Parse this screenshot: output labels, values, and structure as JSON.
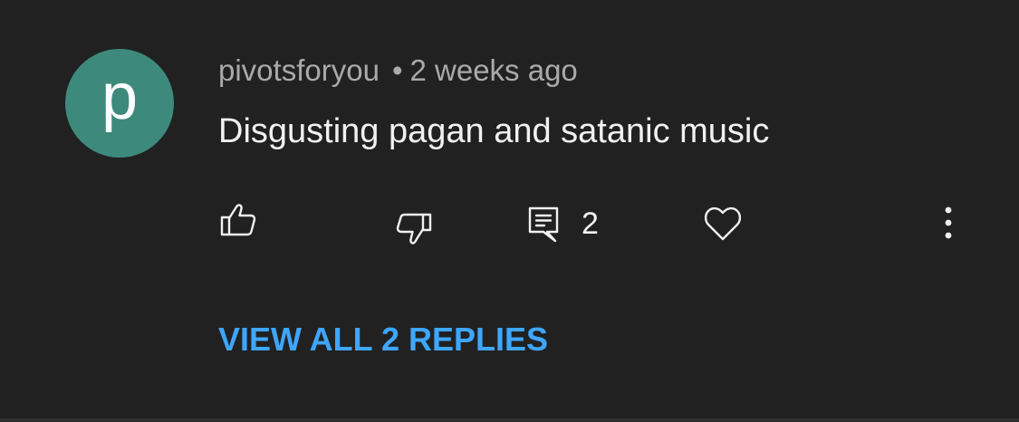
{
  "comment": {
    "avatar_letter": "p",
    "avatar_color": "#3d8a7c",
    "author": "pivotsforyou",
    "separator": "•",
    "timestamp": "2 weeks ago",
    "text": "Disgusting pagan and satanic music",
    "actions": {
      "like_icon": "thumbs-up-icon",
      "dislike_icon": "thumbs-down-icon",
      "reply_icon": "comment-icon",
      "reply_count": "2",
      "heart_icon": "heart-icon",
      "more_icon": "more-vertical-icon"
    },
    "view_replies_label": "VIEW ALL 2 REPLIES",
    "link_color": "#3ea6ff"
  }
}
